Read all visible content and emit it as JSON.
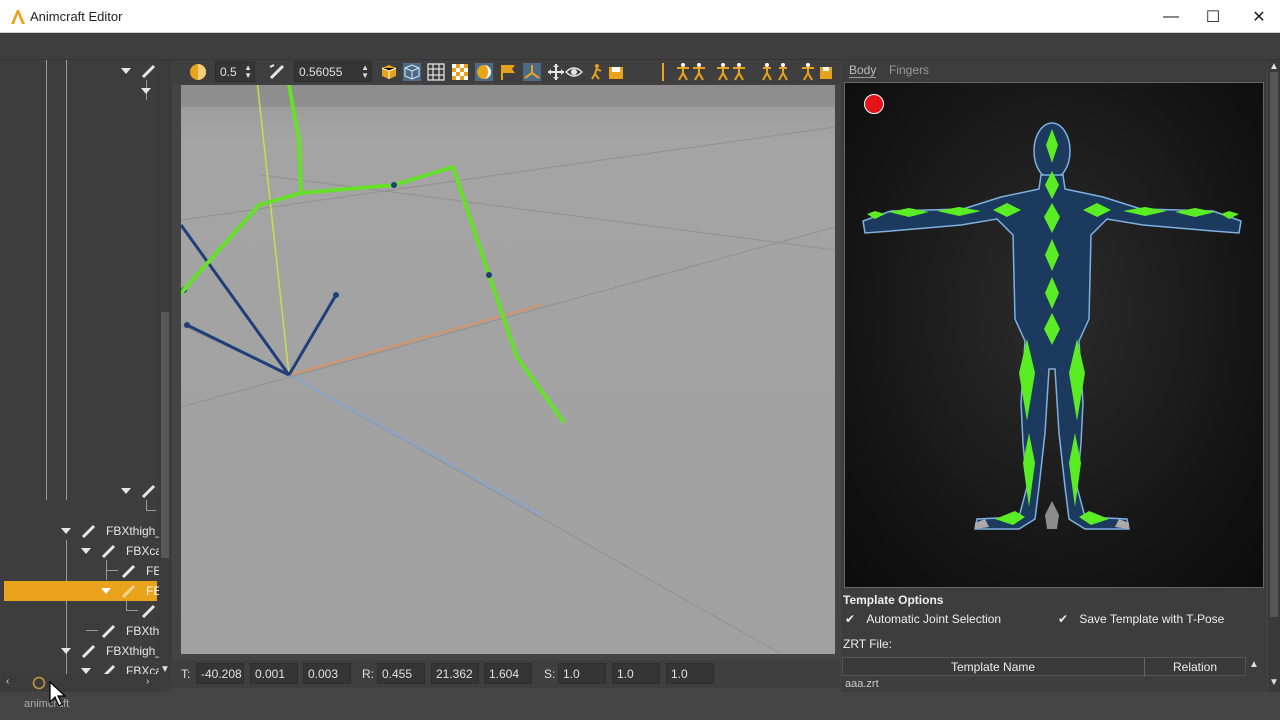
{
  "window": {
    "title": "Animcraft Editor",
    "minimize": "—",
    "maximize": "☐",
    "close": "✕"
  },
  "tree": {
    "items": [
      {
        "label": "FBXthigh_"
      },
      {
        "label": "FBXca"
      },
      {
        "label": "FE"
      },
      {
        "label": "FE"
      },
      {
        "label": "FBXth"
      },
      {
        "label": "FBXthigh_"
      },
      {
        "label": "FBXca"
      }
    ],
    "status": "animcraft"
  },
  "toolbar": {
    "opacity_value": "0.5",
    "bone_size_value": "0.56055"
  },
  "transform": {
    "t_label": "T:",
    "t": [
      "-40.208",
      "0.001",
      "0.003"
    ],
    "r_label": "R:",
    "r": [
      "0.455",
      "21.362",
      "1.604"
    ],
    "s_label": "S:",
    "s": [
      "1.0",
      "1.0",
      "1.0"
    ]
  },
  "panel": {
    "tabs": [
      "Body",
      "Fingers"
    ],
    "template_options_title": "Template Options",
    "auto_joint": "Automatic Joint Selection",
    "save_tpose": "Save Template with T-Pose",
    "zrt_label": "ZRT File:",
    "col_template_name": "Template Name",
    "col_relation": "Relation",
    "rows": [
      "aaa.zrt"
    ]
  },
  "colors": {
    "accent": "#e8a21b",
    "bone_green": "#66e02a",
    "bone_blue": "#1f3e7a",
    "record": "#e2141a"
  }
}
